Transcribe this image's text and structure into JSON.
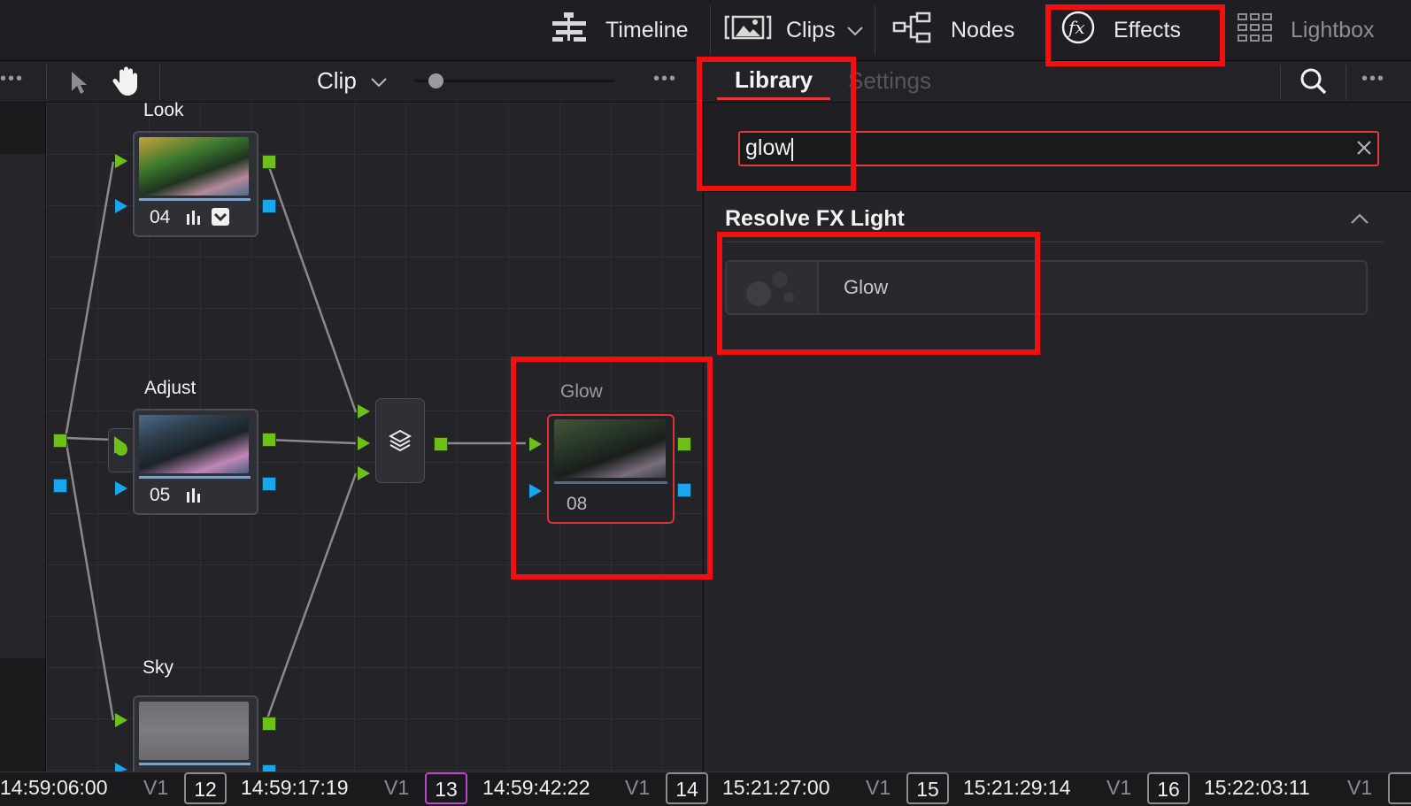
{
  "topbar": {
    "timeline": "Timeline",
    "clips": "Clips",
    "nodes": "Nodes",
    "effects": "Effects",
    "lightbox": "Lightbox"
  },
  "toolbar": {
    "clip_mode": "Clip"
  },
  "effects_panel": {
    "tab_library": "Library",
    "tab_settings": "Settings",
    "search_value": "glow",
    "section_title": "Resolve FX Light",
    "result_name": "Glow"
  },
  "nodes": {
    "look_label": "Look",
    "look_num": "04",
    "adjust_label": "Adjust",
    "adjust_num": "05",
    "glow_label": "Glow",
    "glow_num": "08",
    "sky_label": "Sky"
  },
  "timeline_strip": [
    {
      "tc": "14:59:06:00",
      "track": "V1",
      "clip": "12"
    },
    {
      "tc": "14:59:17:19",
      "track": "V1",
      "clip": "13"
    },
    {
      "tc": "14:59:42:22",
      "track": "V1",
      "clip": "14"
    },
    {
      "tc": "15:21:27:00",
      "track": "V1",
      "clip": "15"
    },
    {
      "tc": "15:21:29:14",
      "track": "V1",
      "clip": "16"
    },
    {
      "tc": "15:22:03:11",
      "track": "V1",
      "clip": ""
    }
  ],
  "colors": {
    "highlight": "#f20f0f",
    "port_green": "#6cc017",
    "port_blue": "#17a7ef",
    "selected_clip": "#c040d0"
  }
}
